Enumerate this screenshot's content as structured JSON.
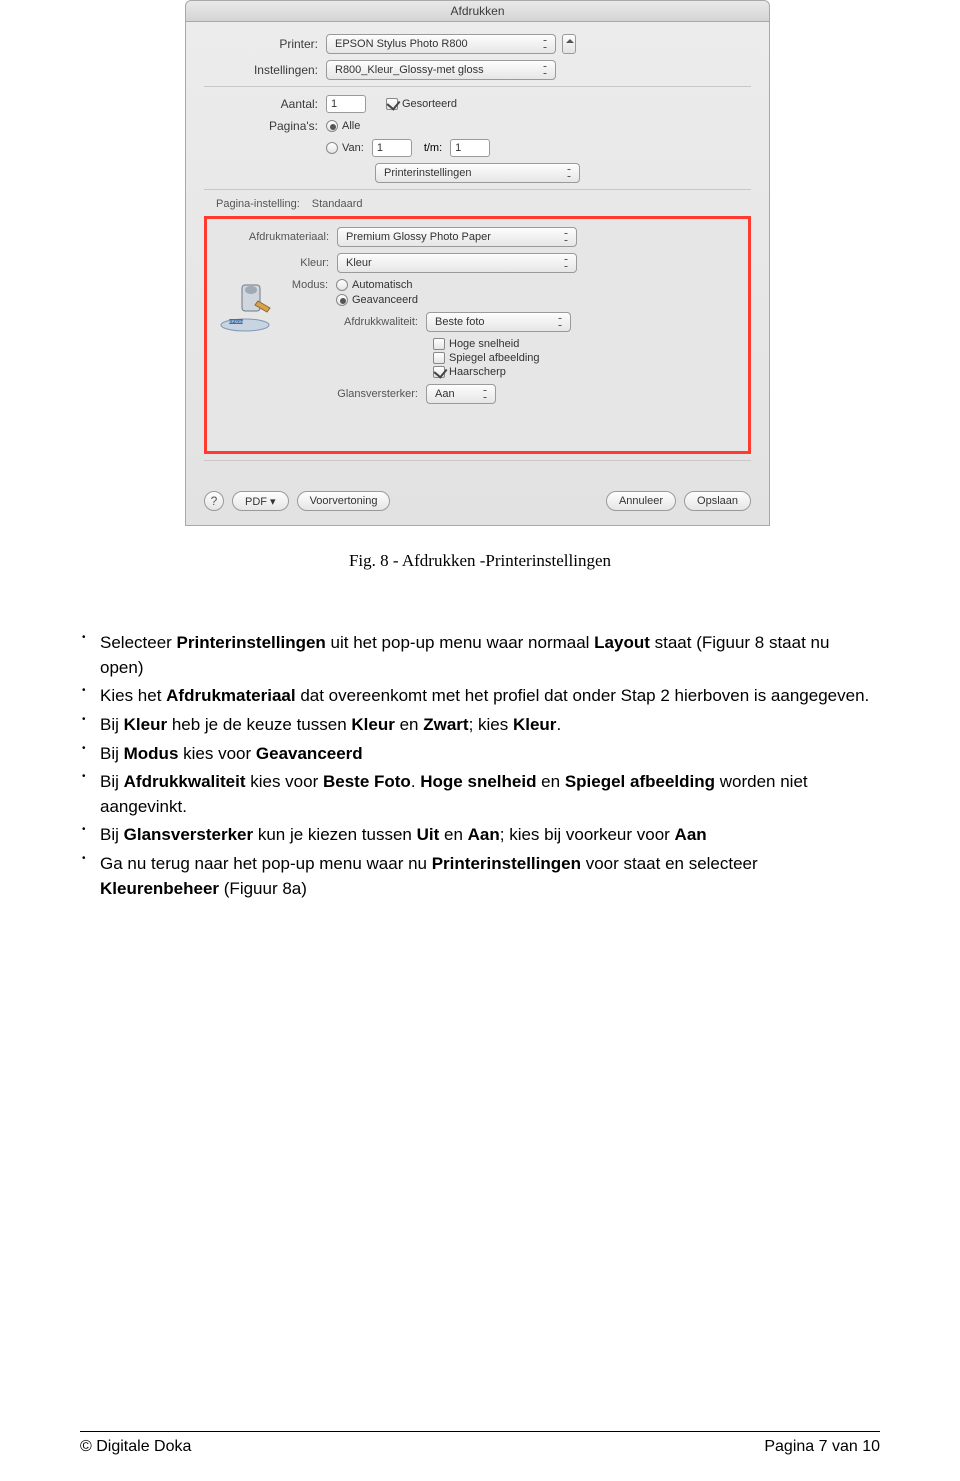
{
  "dialog": {
    "title": "Afdrukken",
    "printer_label": "Printer:",
    "printer_value": "EPSON Stylus Photo R800",
    "settings_label": "Instellingen:",
    "settings_value": "R800_Kleur_Glossy-met gloss",
    "count_label": "Aantal:",
    "count_value": "1",
    "sorted_label": "Gesorteerd",
    "pages_label": "Pagina's:",
    "all_label": "Alle",
    "from_label": "Van:",
    "from_value": "1",
    "to_label": "t/m:",
    "to_value": "1",
    "section_value": "Printerinstellingen",
    "page_setup_label": "Pagina-instelling:",
    "page_setup_value": "Standaard",
    "material_label": "Afdrukmateriaal:",
    "material_value": "Premium Glossy Photo Paper",
    "color_label": "Kleur:",
    "color_value": "Kleur",
    "mode_label": "Modus:",
    "mode_auto": "Automatisch",
    "mode_adv": "Geavanceerd",
    "quality_label": "Afdrukkwaliteit:",
    "quality_value": "Beste foto",
    "high_speed": "Hoge snelheid",
    "mirror": "Spiegel afbeelding",
    "sharp": "Haarscherp",
    "gloss_label": "Glansversterker:",
    "gloss_value": "Aan",
    "pdf_btn": "PDF ▾",
    "preview_btn": "Voorvertoning",
    "cancel_btn": "Annuleer",
    "save_btn": "Opslaan"
  },
  "caption": "Fig. 8 - Afdrukken -Printerinstellingen",
  "body": {
    "li1a": "Selecteer ",
    "li1b": "Printerinstellingen",
    "li1c": " uit het pop-up menu waar normaal ",
    "li1d": "Layout",
    "li1e": " staat (Figuur 8 staat nu open)",
    "li2a": "Kies het ",
    "li2b": "Afdrukmateriaal",
    "li2c": " dat overeenkomt met het profiel dat onder Stap 2 hierboven is aangegeven.",
    "li3a": "Bij ",
    "li3b": "Kleur",
    "li3c": " heb je de keuze tussen ",
    "li3d": "Kleur",
    "li3e": " en  ",
    "li3f": "Zwart",
    "li3g": "; kies ",
    "li3h": "Kleur",
    "li3i": ".",
    "li4a": "Bij ",
    "li4b": "Modus",
    "li4c": " kies voor ",
    "li4d": "Geavanceerd",
    "li5a": "Bij ",
    "li5b": "Afdrukkwaliteit",
    "li5c": " kies voor ",
    "li5d": "Beste Foto",
    "li5e": ". ",
    "li5f": "Hoge snelheid",
    "li5g": " en  ",
    "li5h": "Spiegel afbeelding",
    "li5i": " worden niet aangevinkt.",
    "li6a": "Bij ",
    "li6b": "Glansversterker",
    "li6c": " kun je kiezen tussen ",
    "li6d": "Uit",
    "li6e": " en ",
    "li6f": "Aan",
    "li6g": "; kies bij voorkeur voor ",
    "li6h": "Aan",
    "li7a": "Ga nu terug naar het pop-up menu waar nu ",
    "li7b": "Printerinstellingen",
    "li7c": " voor staat en selecteer ",
    "li7d": "Kleurenbeheer",
    "li7e": " (Figuur 8a)"
  },
  "footer": {
    "left": "© Digitale Doka",
    "right": "Pagina 7 van 10"
  }
}
